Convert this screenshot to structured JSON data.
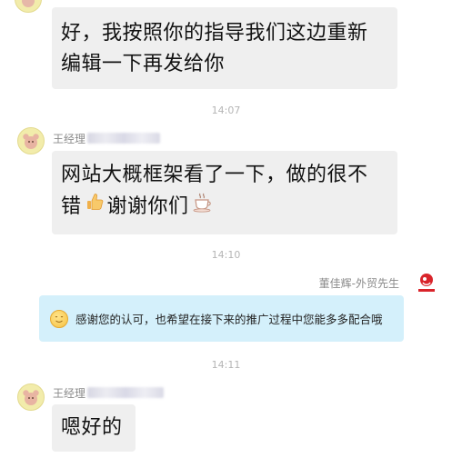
{
  "messages": [
    {
      "lines": [
        "好，我按照你的指导我们这边重新",
        "编辑一下再发给你"
      ]
    },
    {
      "time": "14:07"
    },
    {
      "sender": "王经理",
      "lines": [
        "网站大概框架看了一下，做的很不",
        "错",
        "谢谢你们"
      ],
      "emoji_icons": [
        "thumbs-up-icon",
        "coffee-cup-icon"
      ]
    },
    {
      "time": "14:10"
    },
    {
      "sender": "董佳辉-外贸先生",
      "text": "感谢您的认可，也希望在接下来的推广过程中您能多多配合哦",
      "emoji_icon": "smiling-face-icon"
    },
    {
      "time": "14:11"
    },
    {
      "sender": "王经理",
      "text": "嗯好的"
    }
  ],
  "colors": {
    "incoming_bubble": "#efefef",
    "outgoing_bubble": "#d4f0fb",
    "timestamp": "#b5b5b5",
    "brand_red": "#d9242b"
  }
}
